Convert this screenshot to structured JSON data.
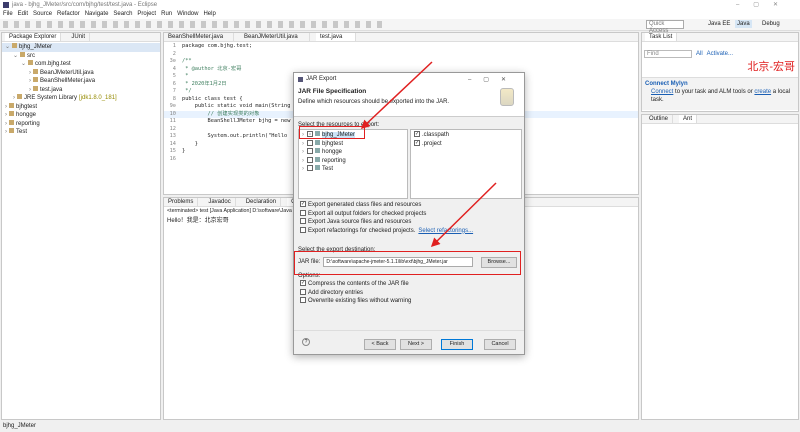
{
  "window": {
    "title": "java - bjhg_JMeter/src/com/bjhg/test/test.java - Eclipse"
  },
  "menu": [
    "File",
    "Edit",
    "Source",
    "Refactor",
    "Navigate",
    "Search",
    "Project",
    "Run",
    "Window",
    "Help"
  ],
  "quick_access": "Quick Access",
  "perspectives": [
    "Java EE",
    "Java",
    "Debug"
  ],
  "package_explorer": {
    "tabs": [
      "Package Explorer",
      "JUnit"
    ],
    "items": [
      {
        "label": "bjhg_JMeter",
        "depth": 0
      },
      {
        "label": "src",
        "depth": 1
      },
      {
        "label": "com.bjhg.test",
        "depth": 2
      },
      {
        "label": "BeanJMeterUtil.java",
        "depth": 3
      },
      {
        "label": "BeanShellMeter.java",
        "depth": 3
      },
      {
        "label": "test.java",
        "depth": 3
      },
      {
        "label": "JRE System Library",
        "extra": "[jdk1.8.0_181]",
        "depth": 1
      },
      {
        "label": "bjhgtest",
        "depth": 0
      },
      {
        "label": "hongge",
        "depth": 0
      },
      {
        "label": "reporting",
        "depth": 0
      },
      {
        "label": "Test",
        "depth": 0
      }
    ]
  },
  "editor": {
    "tabs": [
      "BeanShellMeter.java",
      "BeanJMeterUtil.java",
      "test.java"
    ],
    "lines": [
      {
        "n": "1",
        "t": "package com.bjhg.test;",
        "c": ""
      },
      {
        "n": "2",
        "t": "",
        "c": ""
      },
      {
        "n": "3⊖",
        "t": "/**",
        "c": "cm"
      },
      {
        "n": "4",
        "t": " * @author 北京-宏哥",
        "c": "cm"
      },
      {
        "n": "5",
        "t": " *",
        "c": "cm"
      },
      {
        "n": "6",
        "t": " * 2020年1月2日",
        "c": "cm"
      },
      {
        "n": "7",
        "t": " */",
        "c": "cm"
      },
      {
        "n": "8",
        "t": "public class test {",
        "c": ""
      },
      {
        "n": "9⊖",
        "t": "    public static void main(String",
        "c": ""
      },
      {
        "n": "10",
        "t": "        // 创建实现类的对象",
        "c": "cm"
      },
      {
        "n": "11",
        "t": "        BeanShellJMeter bjhg = new",
        "c": ""
      },
      {
        "n": "12",
        "t": "",
        "c": ""
      },
      {
        "n": "13",
        "t": "        System.out.println(\"Hello",
        "c": ""
      },
      {
        "n": "14",
        "t": "    }",
        "c": ""
      },
      {
        "n": "15",
        "t": "}",
        "c": ""
      },
      {
        "n": "16",
        "t": "",
        "c": ""
      }
    ]
  },
  "console": {
    "tabs": [
      "Problems",
      "Javadoc",
      "Declaration",
      "Console"
    ],
    "terminated": "<terminated> test [Java Application] D:\\software\\Java",
    "output": "Hello！我是：北京宏哥"
  },
  "task_list": {
    "tab": "Task List",
    "find_placeholder": "Find",
    "all": "All",
    "activate": "Activate...",
    "watermark": "北京-宏哥"
  },
  "mylyn": {
    "title": "Connect Mylyn",
    "connect": "Connect",
    "text1": " to your task and ALM tools or ",
    "create": "create",
    "text2": " a local task."
  },
  "outline": {
    "tabs": [
      "Outline",
      "Ant"
    ]
  },
  "status": "bjhg_JMeter",
  "dialog": {
    "title": "JAR Export",
    "heading": "JAR File Specification",
    "description": "Define which resources should be exported into the JAR.",
    "resources_label": "Select the resources to export:",
    "projects": [
      {
        "label": "bjhg_JMeter",
        "state": "partial"
      },
      {
        "label": "bjhgtest",
        "state": "off"
      },
      {
        "label": "hongge",
        "state": "off"
      },
      {
        "label": "reporting",
        "state": "off"
      },
      {
        "label": "Test",
        "state": "off"
      }
    ],
    "files": [
      {
        "label": ".classpath",
        "checked": true
      },
      {
        "label": ".project",
        "checked": true
      }
    ],
    "export_options": [
      {
        "label": "Export generated class files and resources",
        "checked": true
      },
      {
        "label": "Export all output folders for checked projects",
        "checked": false
      },
      {
        "label": "Export Java source files and resources",
        "checked": false
      },
      {
        "label": "Export refactorings for checked projects.",
        "checked": false
      }
    ],
    "select_refactorings": "Select refactorings...",
    "destination_label": "Select the export destination:",
    "jar_file_label": "JAR file:",
    "jar_file_value": "D:\\software\\apache-jmeter-5.1.1\\lib\\ext\\bjhg_JMeter.jar",
    "browse": "Browse...",
    "options_label": "Options:",
    "options": [
      {
        "label": "Compress the contents of the JAR file",
        "checked": true
      },
      {
        "label": "Add directory entries",
        "checked": false
      },
      {
        "label": "Overwrite existing files without warning",
        "checked": false
      }
    ],
    "buttons": {
      "back": "< Back",
      "next": "Next >",
      "finish": "Finish",
      "cancel": "Cancel"
    }
  },
  "colors": {
    "annotation": "#e02020",
    "link": "#1a5fb4"
  }
}
